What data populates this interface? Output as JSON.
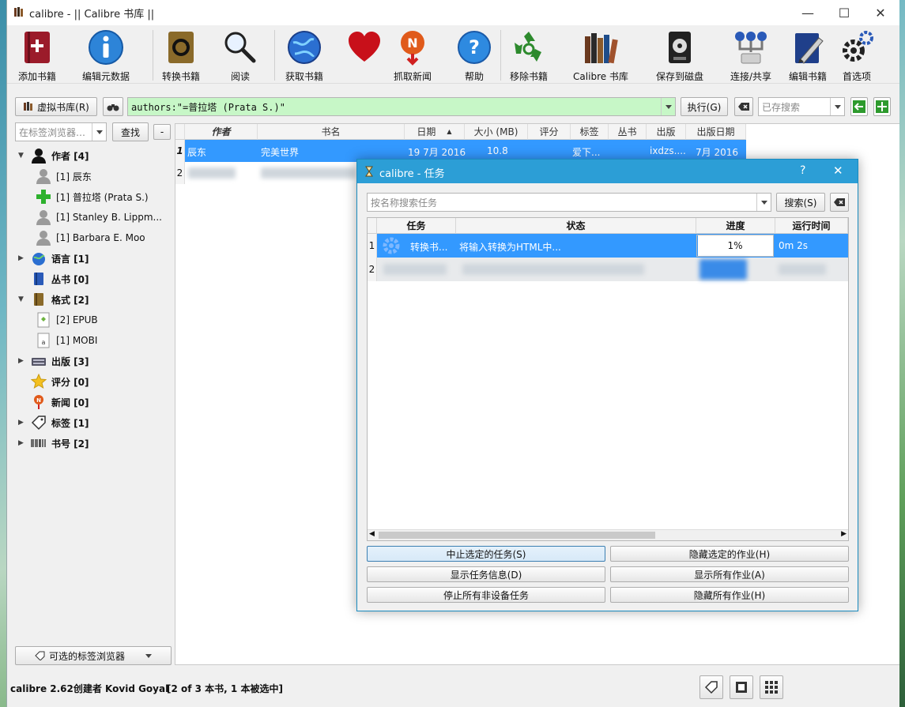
{
  "window": {
    "title": "calibre - || Calibre 书库 ||"
  },
  "toolbar": {
    "add_books": "添加书籍",
    "edit_metadata": "编辑元数据",
    "convert_books": "转换书籍",
    "read": "阅读",
    "get_books": "获取书籍",
    "fetch_news": "抓取新闻",
    "help": "帮助",
    "remove_books": "移除书籍",
    "calibre_library": "Calibre 书库",
    "save_to_disk": "保存到磁盘",
    "connect_share": "连接/共享",
    "edit_book": "编辑书籍",
    "preferences": "首选项"
  },
  "search": {
    "virtual_library": "虚拟书库(R)",
    "query": "authors:\"=普拉塔 (Prata S.)\"",
    "execute": "执行(G)",
    "saved_search_placeholder": "已存搜索"
  },
  "tag_browser": {
    "search_placeholder": "在标签浏览器…",
    "find": "查找",
    "collapse": "-",
    "optional_browser": "可选的标签浏览器",
    "items": [
      {
        "label": "作者 [4]"
      },
      {
        "label": "[1] 辰东"
      },
      {
        "label": "[1] 普拉塔 (Prata S.)"
      },
      {
        "label": "[1] Stanley B. Lippm..."
      },
      {
        "label": "[1] Barbara E. Moo"
      },
      {
        "label": "语言 [1]"
      },
      {
        "label": "丛书 [0]"
      },
      {
        "label": "格式 [2]"
      },
      {
        "label": "[2] EPUB"
      },
      {
        "label": "[1] MOBI"
      },
      {
        "label": "出版 [3]"
      },
      {
        "label": "评分 [0]"
      },
      {
        "label": "新闻 [0]"
      },
      {
        "label": "标签 [1]"
      },
      {
        "label": "书号 [2]"
      }
    ]
  },
  "book_table": {
    "headers": [
      "作者",
      "书名",
      "日期",
      "大小 (MB)",
      "评分",
      "标签",
      "丛书",
      "出版",
      "出版日期"
    ],
    "rows": [
      {
        "num": "1",
        "author": "辰东",
        "title": "完美世界",
        "date": "19 7月 2016",
        "size": "10.8",
        "rating": "",
        "tags": "爱下...",
        "series": "",
        "publisher": "ixdzs....",
        "pubdate": "7月 2016"
      },
      {
        "num": "2"
      }
    ]
  },
  "status": {
    "text": "calibre 2.62创建者 Kovid Goyal",
    "count": "[2 of 3 本书, 1 本被选中]"
  },
  "jobs_dialog": {
    "title": "calibre - 任务",
    "help": "?",
    "search_placeholder": "按名称搜索任务",
    "search_button": "搜索(S)",
    "headers": [
      "任务",
      "状态",
      "进度",
      "运行时间"
    ],
    "rows": [
      {
        "num": "1",
        "task": "转换书...",
        "status": "将输入转换为HTML中...",
        "progress": "1%",
        "progress_value": 0.01,
        "time": "0m 2s"
      },
      {
        "num": "2"
      }
    ],
    "buttons": {
      "abort_selected": "中止选定的任务(S)",
      "hide_selected": "隐藏选定的作业(H)",
      "show_info": "显示任务信息(D)",
      "show_all": "显示所有作业(A)",
      "stop_all_non_device": "停止所有非设备任务",
      "hide_all": "隐藏所有作业(H)"
    }
  },
  "colors": {
    "selection": "#3399ff",
    "search_bg": "#c7f7c7",
    "dialog_title": "#2c9ed6"
  }
}
